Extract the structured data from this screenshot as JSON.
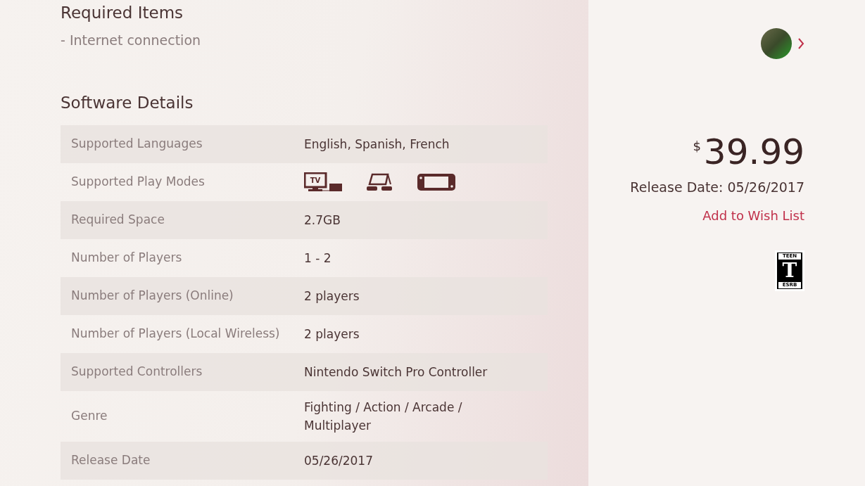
{
  "required_items": {
    "title": "Required Items",
    "items": [
      "- Internet connection"
    ]
  },
  "software_details": {
    "title": "Software Details",
    "rows": [
      {
        "kind": "text",
        "label": "Supported Languages",
        "value": "English, Spanish, French"
      },
      {
        "kind": "play_modes",
        "label": "Supported Play Modes",
        "modes": [
          {
            "kind": "tv",
            "label": "TV"
          },
          {
            "kind": "tabletop"
          },
          {
            "kind": "handheld"
          }
        ]
      },
      {
        "kind": "text",
        "label": "Required Space",
        "value": "2.7GB"
      },
      {
        "kind": "text",
        "label": "Number of Players",
        "value": "1 - 2"
      },
      {
        "kind": "text",
        "label": "Number of Players (Online)",
        "value": "2 players"
      },
      {
        "kind": "text",
        "label": "Number of Players (Local Wireless)",
        "value": "2 players"
      },
      {
        "kind": "text",
        "label": "Supported Controllers",
        "value": "Nintendo Switch Pro Controller"
      },
      {
        "kind": "text",
        "label": "Genre",
        "value": "Fighting / Action / Arcade / Multiplayer"
      },
      {
        "kind": "text",
        "label": "Release Date",
        "value": "05/26/2017"
      }
    ]
  },
  "sidebar": {
    "currency": "$",
    "price": "39.99",
    "release_date": "Release Date: 05/26/2017",
    "wish_list": "Add to Wish List",
    "rating": {
      "label": "TEEN",
      "letter": "T",
      "org": "ESRB"
    }
  }
}
